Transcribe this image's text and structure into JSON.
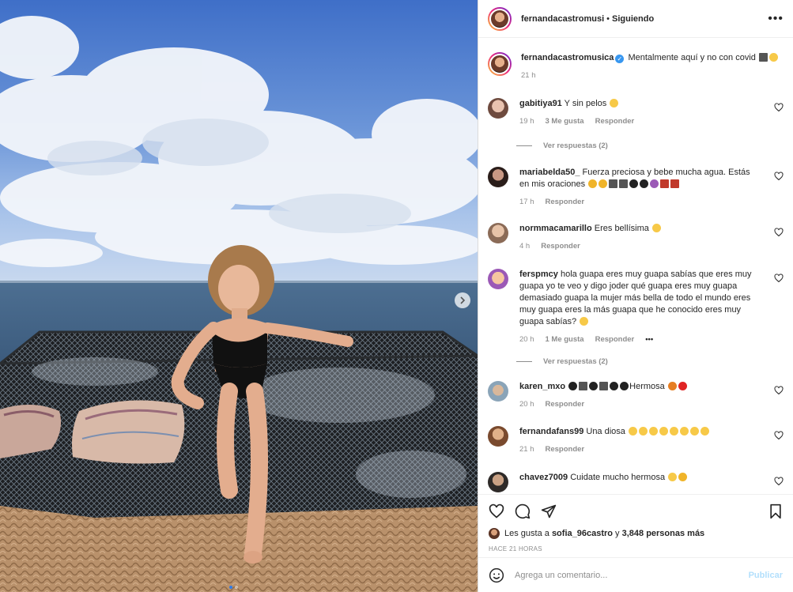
{
  "post": {
    "author": "fernandacastromusi",
    "separator": "•",
    "follow_status": "Siguiendo",
    "more_icon": "ellipsis-icon"
  },
  "caption": {
    "username": "fernandacastromusica",
    "text": "Mentalmente aquí y no con covid",
    "time": "21 h"
  },
  "comments": [
    {
      "username": "gabitiya91",
      "text": "Y sin pelos",
      "time": "19 h",
      "likes": "3 Me gusta",
      "reply": "Responder",
      "view_replies": "Ver respuestas (2)"
    },
    {
      "username": "mariabelda50_",
      "text": "Fuerza preciosa y bebe mucha agua. Estás en mis oraciones",
      "time": "17 h",
      "reply": "Responder"
    },
    {
      "username": "normmacamarillo",
      "text": "Eres bellísima",
      "time": "4 h",
      "reply": "Responder"
    },
    {
      "username": "fersрmcy",
      "text": "hola guapa eres muy guapa sabías que eres muy guapa yo te veo y digo joder qué guapa eres muy guapa demasiado guapa la mujer más bella de todo el mundo eres muy guapa eres la más guapa que he conocido eres muy guapa sabías?",
      "time": "20 h",
      "likes": "1 Me gusta",
      "reply": "Responder",
      "more": "•••",
      "view_replies": "Ver respuestas (2)"
    },
    {
      "username": "karen_mxo",
      "text": "Hermosa",
      "time": "20 h",
      "reply": "Responder"
    },
    {
      "username": "fernandafans99",
      "text": "Una diosa",
      "time": "21 h",
      "reply": "Responder"
    },
    {
      "username": "chavez7009",
      "text": "Cuidate mucho hermosa"
    }
  ],
  "likes": {
    "prefix": "Les gusta a",
    "user": "sofia_96castro",
    "connector": "y",
    "count": "3,848 personas más"
  },
  "posted_ago": "HACE 21 HORAS",
  "add_comment": {
    "placeholder": "Agrega un comentario...",
    "publish": "Publicar"
  },
  "colors": {
    "accent": "#3897f0",
    "publish_disabled": "#b2dffc",
    "muted_text": "#8e8e8e"
  }
}
